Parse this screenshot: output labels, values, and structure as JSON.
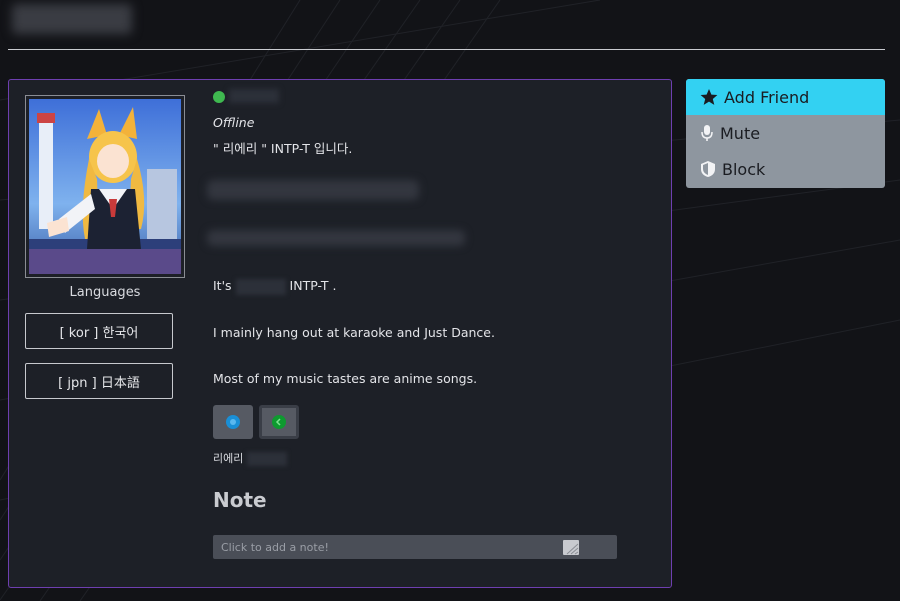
{
  "profile": {
    "status": "Offline",
    "status_color": "#3fb950",
    "bio_line": "\" 리에리 \" INTP-T 입니다.",
    "about": {
      "line1_prefix": "It's",
      "line1_suffix": "INTP-T .",
      "line2": "I mainly hang out at karaoke and Just Dance.",
      "line3": "Most of my music tastes are anime songs."
    },
    "languages_title": "Languages",
    "languages": [
      {
        "label": "[ kor ] 한국어"
      },
      {
        "label": "[ jpn ] 日本語"
      }
    ],
    "connection_label": "리에리",
    "note": {
      "heading": "Note",
      "placeholder": "Click to add a note!"
    },
    "border_color": "#6e3fb0"
  },
  "actions": {
    "add_friend": "Add Friend",
    "mute": "Mute",
    "block": "Block",
    "accent": "#33d1f2"
  }
}
